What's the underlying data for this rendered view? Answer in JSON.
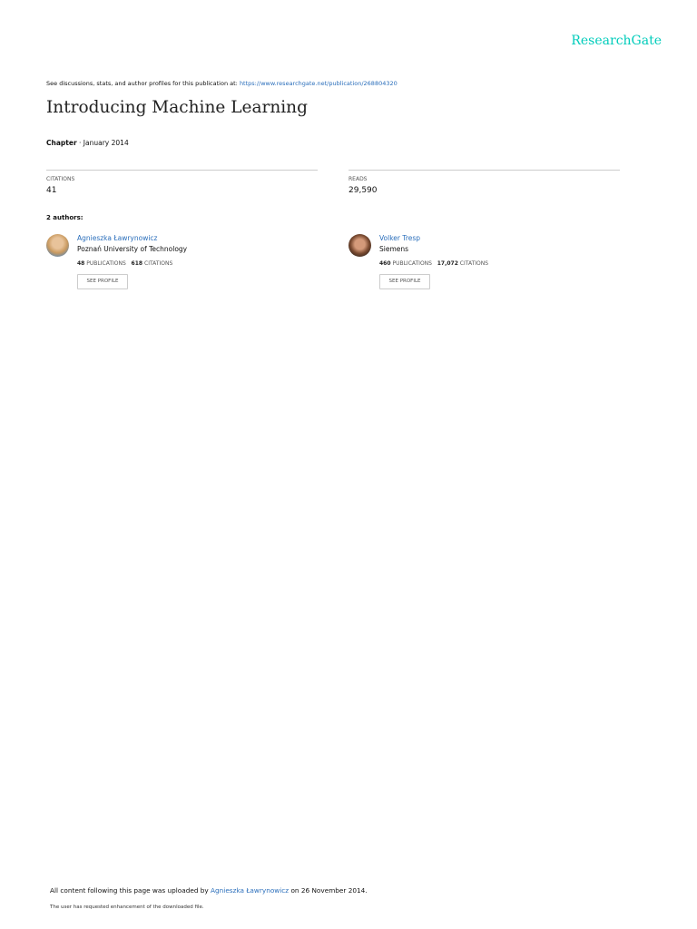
{
  "logo": "ResearchGate",
  "header": {
    "prefix": "See discussions, stats, and author profiles for this publication at: ",
    "url": "https://www.researchgate.net/publication/268804320"
  },
  "title": "Introducing Machine Learning",
  "meta": {
    "type": "Chapter",
    "date": " · January 2014"
  },
  "stats": {
    "citations_label": "CITATIONS",
    "citations": "41",
    "reads_label": "READS",
    "reads": "29,590"
  },
  "authors_label": "2 authors:",
  "authors": [
    {
      "name": "Agnieszka Ławrynowicz",
      "affiliation": "Poznań University of Technology",
      "publications": "48",
      "publications_label": "PUBLICATIONS",
      "citations": "618",
      "citations_label": "CITATIONS",
      "button": "SEE PROFILE"
    },
    {
      "name": "Volker Tresp",
      "affiliation": "Siemens",
      "publications": "460",
      "publications_label": "PUBLICATIONS",
      "citations": "17,072",
      "citations_label": "CITATIONS",
      "button": "SEE PROFILE"
    }
  ],
  "footer": {
    "prefix": "All content following this page was uploaded by ",
    "uploader": "Agnieszka Ławrynowicz",
    "suffix": " on 26 November 2014.",
    "note": "The user has requested enhancement of the downloaded file."
  }
}
